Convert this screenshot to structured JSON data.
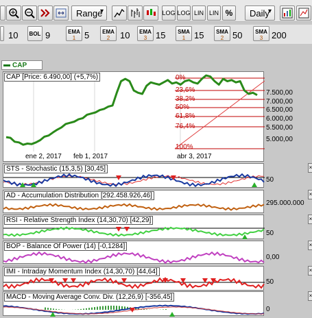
{
  "toolbar": {
    "range_label": "Range",
    "period_label": "Daily",
    "log_labels": [
      "LOG",
      "LOG",
      "LIN",
      "LIN"
    ],
    "percent_label": "%"
  },
  "indicator_bar": {
    "params": [
      "10",
      "9",
      "5",
      "10",
      "15",
      "15",
      "50",
      "200"
    ],
    "buttons": [
      {
        "label": "BOL",
        "sub": ""
      },
      {
        "label": "EMA",
        "sub": "1"
      },
      {
        "label": "EMA",
        "sub": "2"
      },
      {
        "label": "EMA",
        "sub": "3"
      },
      {
        "label": "SMA",
        "sub": "1"
      },
      {
        "label": "SMA",
        "sub": "2"
      },
      {
        "label": "SMA",
        "sub": "3"
      }
    ]
  },
  "legend": {
    "label": "CAP",
    "color": "#1a7a1a"
  },
  "main_chart": {
    "title": "CAP [Price: 6.490,00] (+5,7%)",
    "y_ticks": [
      "7.500,00",
      "7.000,00",
      "6.500,00",
      "6.000,00",
      "5.500,00",
      "5.000,00"
    ],
    "x_ticks": [
      "ene 2, 2017",
      "feb 1, 2017",
      "abr 3, 2017"
    ],
    "fibo_levels": [
      "0%",
      "23,6%",
      "38,2%",
      "50%",
      "61,8%",
      "76,4%",
      "100%"
    ]
  },
  "panels": [
    {
      "title": "STS - Stochastic (15,3,5) [30,45]",
      "axis": "50"
    },
    {
      "title": "AD - Accumulation Distribution [292.458.926,46]",
      "axis": "295.000.000"
    },
    {
      "title": "RSI - Relative Strength Index (14,30,70) [42,29]",
      "axis": "50"
    },
    {
      "title": "BOP - Balance Of Power (14) [-0,1284]",
      "axis": "0,00"
    },
    {
      "title": "IMI - Intraday Momentum Index (14,30,70) [44,64]",
      "axis": "50"
    },
    {
      "title": "MACD - Moving Average Conv. Div. (12,26,9) [-356,45]",
      "axis": "0"
    }
  ],
  "chart_data": {
    "type": "line",
    "title": "CAP [Price: 6.490,00] (+5,7%)",
    "xlabel": "",
    "ylabel": "",
    "ylim": [
      4500,
      8000
    ],
    "series": [
      {
        "name": "CAP",
        "x": [
          0,
          2,
          4,
          6,
          8,
          10,
          12,
          14,
          16,
          18,
          20,
          22,
          24,
          26,
          28,
          30,
          32,
          34,
          36,
          38,
          40,
          42,
          44,
          46,
          48,
          50,
          52,
          54,
          56,
          58,
          60,
          62,
          64,
          66,
          68,
          70,
          72,
          74,
          76,
          78,
          80,
          82,
          84,
          86,
          88,
          90,
          92,
          94,
          96,
          98,
          100,
          102,
          104,
          106,
          108,
          110,
          112,
          114,
          116,
          118
        ],
        "values": [
          5180,
          5150,
          4980,
          4950,
          4850,
          4900,
          4880,
          4950,
          5050,
          5200,
          5250,
          5380,
          5500,
          5600,
          5750,
          5800,
          5850,
          5950,
          6000,
          6150,
          6200,
          6250,
          6350,
          6400,
          6500,
          6550,
          7100,
          7600,
          7700,
          7600,
          7200,
          7100,
          7050,
          7400,
          7550,
          7500,
          7450,
          7550,
          7650,
          7500,
          7550,
          7450,
          7600,
          7650,
          7550,
          7500,
          7700,
          7850,
          7800,
          7600,
          7450,
          7700,
          7600,
          7650,
          7550,
          7600,
          7200,
          7050,
          7100,
          7000
        ]
      }
    ]
  }
}
